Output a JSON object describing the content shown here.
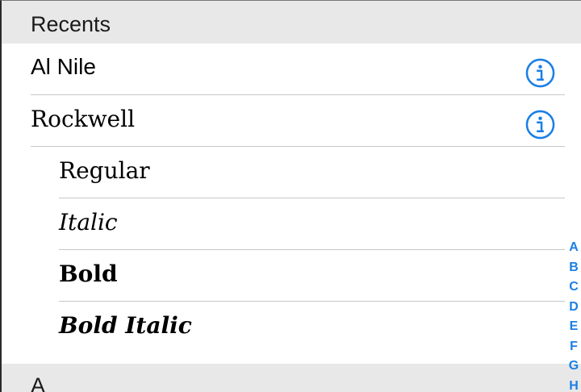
{
  "recents_header": "Recents",
  "recent_fonts": [
    {
      "label": "Al Nile"
    },
    {
      "label": "Rockwell"
    }
  ],
  "rockwell_styles": [
    {
      "label": "Regular"
    },
    {
      "label": "Italic"
    },
    {
      "label": "Bold"
    },
    {
      "label": "Bold Italic"
    }
  ],
  "section_a_header": "A",
  "index_letters": [
    "A",
    "B",
    "C",
    "D",
    "E",
    "F",
    "G",
    "H"
  ],
  "colors": {
    "accent": "#1a7fe6",
    "header_bg": "#e8e8e8",
    "separator": "#c8c8cc"
  },
  "icons": {
    "info": "info-circle-icon"
  }
}
